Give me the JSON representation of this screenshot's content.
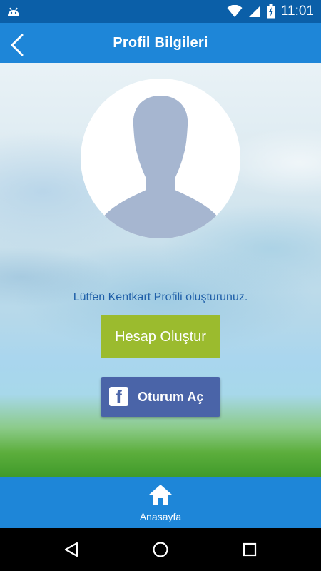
{
  "status_bar": {
    "time": "11:01",
    "icons": [
      "android-icon",
      "wifi-icon",
      "cell-signal-icon",
      "battery-charging-icon"
    ]
  },
  "app_bar": {
    "title": "Profil Bilgileri",
    "back_icon": "chevron-left-icon"
  },
  "profile": {
    "avatar_icon": "person-silhouette-icon",
    "prompt": "Lütfen Kentkart Profili oluşturunuz.",
    "create_account_label": "Hesap Oluştur",
    "facebook_login_label": "Oturum Aç",
    "facebook_icon_glyph": "f"
  },
  "bottom_nav": {
    "home_label": "Anasayfa",
    "home_icon": "home-icon"
  },
  "system_nav": {
    "buttons": [
      "back-triangle-icon",
      "home-circle-icon",
      "recents-square-icon"
    ]
  },
  "colors": {
    "primary": "#1e86d8",
    "status_bar": "#0b5fa8",
    "create_button": "#9bbb2e",
    "facebook": "#4a64a8",
    "prompt_text": "#1f5fa8",
    "avatar_silhouette": "#a6b6d0"
  }
}
